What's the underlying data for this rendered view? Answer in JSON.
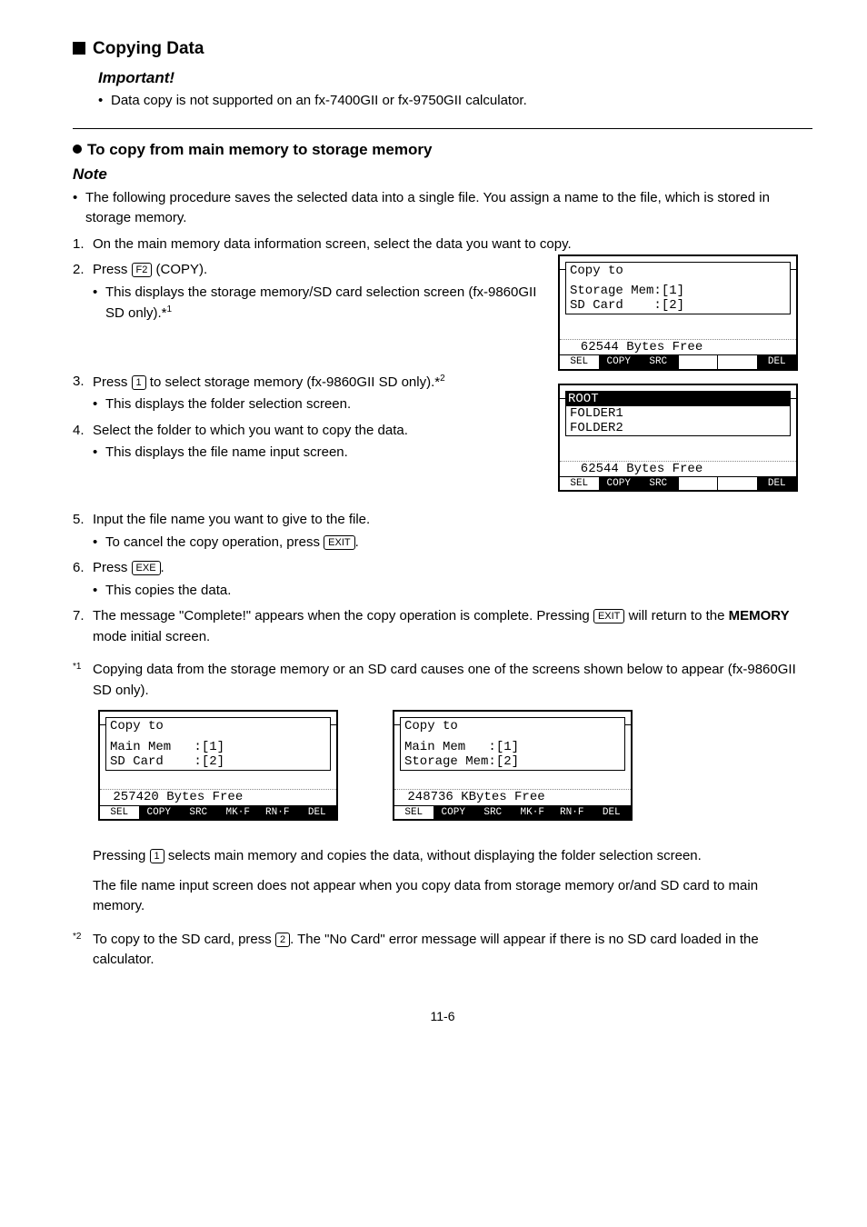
{
  "heading": "Copying Data",
  "important_label": "Important!",
  "important_text": "Data copy is not supported on an fx-7400GII or fx-9750GII calculator.",
  "sub_heading": "To copy from main memory to storage memory",
  "note_label": "Note",
  "note_text": "The following procedure saves the selected data into a single file. You assign a name to the file, which is stored in storage memory.",
  "step1": "On the main memory data information screen, select the data you want to copy.",
  "step2_a": "Press ",
  "step2_key": "F2",
  "step2_b": "(COPY).",
  "step2_sub_a": "This displays the storage memory/SD card selection screen (fx-9860GII SD only).*",
  "step2_sup": "1",
  "step3_a": "Press ",
  "step3_key": "1",
  "step3_b": " to select storage memory (fx-9860GII SD only).*",
  "step3_sup": "2",
  "step3_sub": "This displays the folder selection screen.",
  "step4": "Select the folder to which you want to copy the data.",
  "step4_sub": "This displays the file name input screen.",
  "step5": "Input the file name you want to give to the file.",
  "step5_sub_a": "To cancel the copy operation, press ",
  "step5_key": "EXIT",
  "step5_sub_b": ".",
  "step6_a": "Press ",
  "step6_key": "EXE",
  "step6_b": ".",
  "step6_sub": "This copies the data.",
  "step7_a": "The message \"Complete!\" appears when the copy operation is complete. Pressing ",
  "step7_key": "EXIT",
  "step7_b": " will return to the ",
  "step7_bold": "MEMORY",
  "step7_c": " mode initial screen.",
  "fn1_mark": "*1",
  "fn1_text": "Copying data from the storage memory or an SD card causes one of the screens shown below to appear (fx-9860GII SD only).",
  "fn1_p1_a": "Pressing ",
  "fn1_p1_key": "1",
  "fn1_p1_b": " selects main memory and copies the data, without displaying the folder selection screen.",
  "fn1_p2": "The file name input screen does not appear when you copy data from storage memory or/and SD card to main memory.",
  "fn2_mark": "*2",
  "fn2_a": "To copy to the SD card, press ",
  "fn2_key": "2",
  "fn2_b": ". The \"No Card\" error message will appear if there is no SD card loaded in the calculator.",
  "pagenum": "11-6",
  "lcd1": {
    "title": "Copy to",
    "line1": "Storage Mem:[1]",
    "line2": "SD Card    :[2]",
    "status": "  62544 Bytes Free",
    "sk1": "SEL",
    "sk2": "COPY",
    "sk3": "SRC",
    "sk6": "DEL"
  },
  "lcd2": {
    "rootline": "ROOT",
    "line1": "FOLDER1",
    "line2": "FOLDER2",
    "status": "  62544 Bytes Free",
    "sk1": "SEL",
    "sk2": "COPY",
    "sk3": "SRC",
    "sk6": "DEL"
  },
  "lcd3": {
    "title": "Copy to",
    "line1": "Main Mem   :[1]",
    "line2": "SD Card    :[2]",
    "status": " 257420 Bytes Free",
    "sk1": "SEL",
    "sk2": "COPY",
    "sk3": "SRC",
    "sk4": "MK·F",
    "sk5": "RN·F",
    "sk6": "DEL"
  },
  "lcd4": {
    "title": "Copy to",
    "line1": "Main Mem   :[1]",
    "line2": "Storage Mem:[2]",
    "status": " 248736 KBytes Free",
    "sk1": "SEL",
    "sk2": "COPY",
    "sk3": "SRC",
    "sk4": "MK·F",
    "sk5": "RN·F",
    "sk6": "DEL"
  }
}
